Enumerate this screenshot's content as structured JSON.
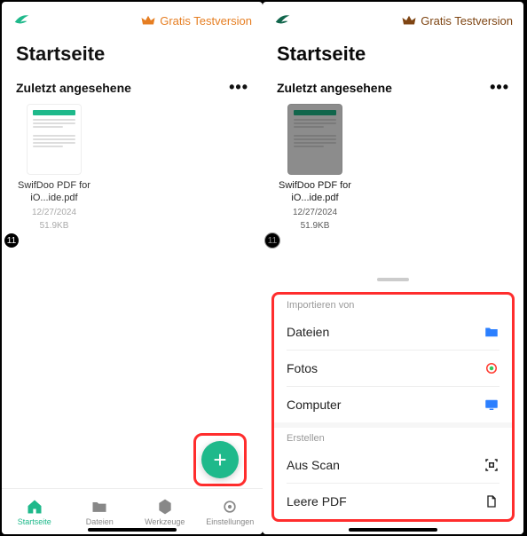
{
  "trial_label": "Gratis Testversion",
  "page_title": "Startseite",
  "section_recent": "Zuletzt angesehene",
  "file": {
    "name": "SwifDoo PDF for iO...ide.pdf",
    "date": "12/27/2024",
    "size": "51.9KB"
  },
  "badge_count": "11",
  "tabs": {
    "home": "Startseite",
    "files": "Dateien",
    "tools": "Werkzeuge",
    "settings": "Einstellungen"
  },
  "sheet": {
    "import_label": "Importieren von",
    "files": "Dateien",
    "photos": "Fotos",
    "computer": "Computer",
    "create_label": "Erstellen",
    "scan": "Aus Scan",
    "blank": "Leere PDF"
  }
}
